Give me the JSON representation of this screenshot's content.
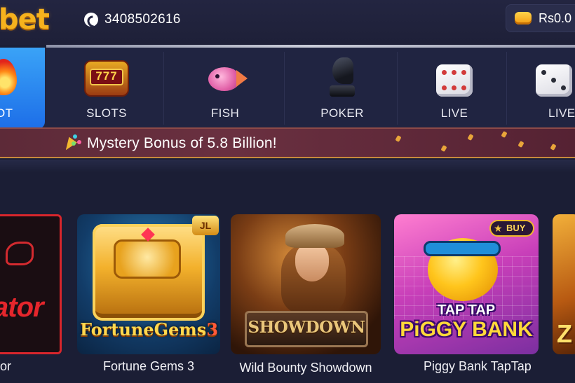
{
  "header": {
    "logo_text": "bet",
    "phone_number": "3408502616",
    "balance": "Rs0.0"
  },
  "nav": {
    "items": [
      {
        "label": "OT",
        "icon": "flame-icon",
        "active": true
      },
      {
        "label": "SLOTS",
        "icon": "slot-machine-icon",
        "icon_text": "777"
      },
      {
        "label": "FISH",
        "icon": "fish-icon"
      },
      {
        "label": "POKER",
        "icon": "chess-knight-icon"
      },
      {
        "label": "LIVE",
        "icon": "dice-icon"
      },
      {
        "label": "LIVE",
        "icon": "dice-icon"
      }
    ]
  },
  "banner": {
    "text": "Mystery Bonus of 5.8 Billion!",
    "icon": "party-popper-icon"
  },
  "games": [
    {
      "title": "or",
      "art_text": "ator"
    },
    {
      "title": "Fortune Gems 3",
      "badge": "JL",
      "art_text": "FortuneGems",
      "art_number": "3"
    },
    {
      "title": "Wild Bounty Showdown",
      "art_text": "SHOWDOWN"
    },
    {
      "title": "Piggy Bank TapTap",
      "badge": "BUY",
      "art_text_top": "TAP TAP",
      "art_text_bottom": "PiGGY BANK"
    },
    {
      "title": "",
      "art_text": "Z"
    }
  ],
  "colors": {
    "background": "#1b1e35",
    "nav_active": "#1d6ee8",
    "logo": "#f6b21d",
    "banner": "#6a3040"
  }
}
